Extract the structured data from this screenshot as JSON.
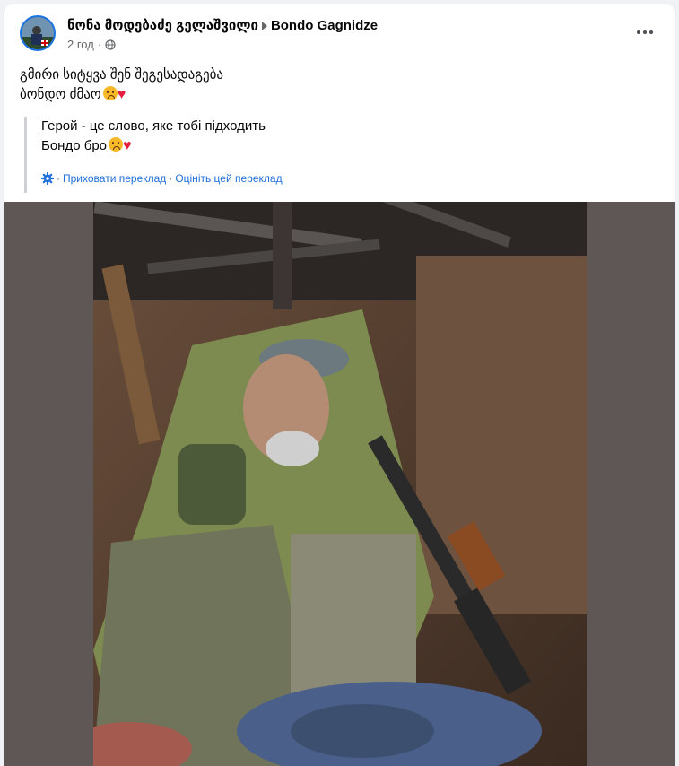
{
  "post": {
    "author": "ნონა მოდებაძე გელაშვილი",
    "recipient": "Bondo Gagnidze",
    "time": "2 год",
    "audience_icon": "globe-icon",
    "text_line1": "გმირი სიტყვა შენ შეგესადაგება",
    "text_line2": "ბონდო ძმაო",
    "translation": {
      "line1": "Герой - це слово, яке тобі підходить",
      "line2": "Бондо бро",
      "hide_label": "Приховати переклад",
      "rate_label": "Оцініть цей переклад",
      "separator": "·"
    }
  },
  "colors": {
    "link": "#216fdb",
    "secondary_text": "#65676b",
    "photo_background": "#5e5756",
    "heart": "#e41e3f"
  }
}
